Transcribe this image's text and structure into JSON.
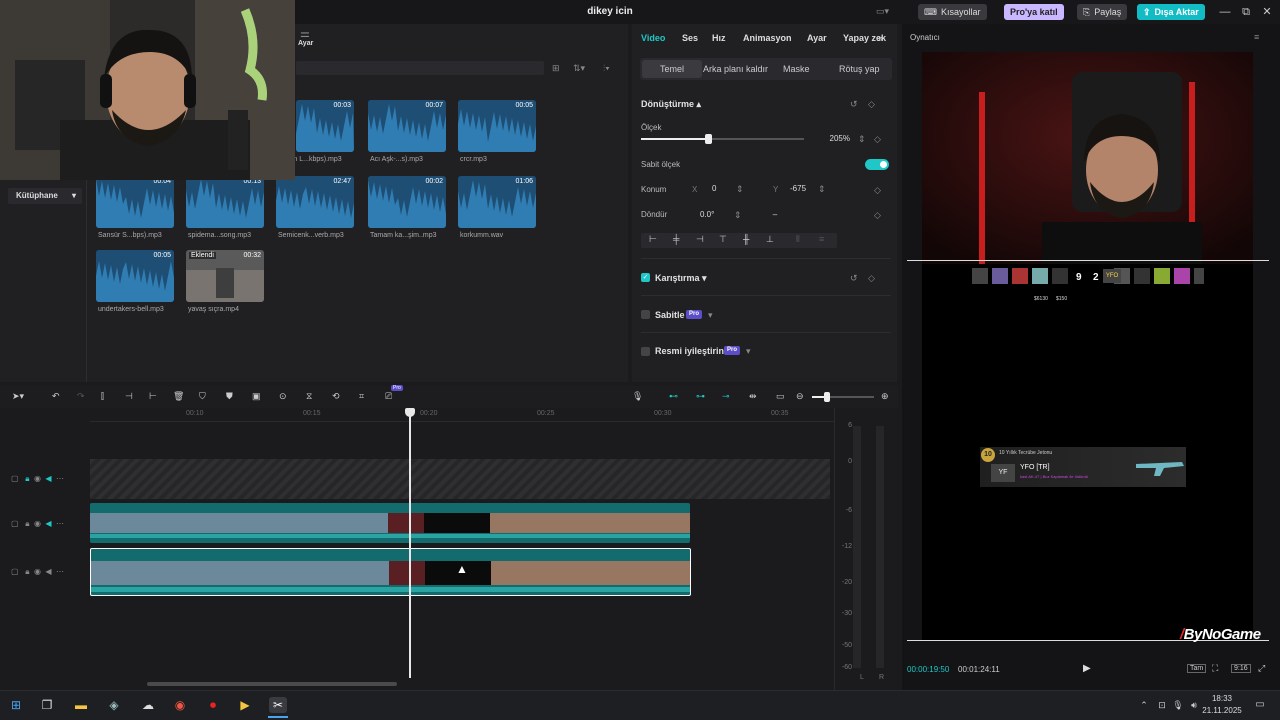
{
  "window": {
    "title": "dikey icin",
    "shortcuts_label": "Kısayollar",
    "pro_label": "Pro'ya katıl",
    "share_label": "Paylaş",
    "export_label": "Dışa Aktar",
    "minimize": "—",
    "maximize": "⧉",
    "close": "✕"
  },
  "media": {
    "settings_label": "Ayar",
    "library_label": "Kütüphane",
    "items": [
      {
        "name": "...in L...kbps).mp3",
        "duration": "00:03"
      },
      {
        "name": "Acı Aşk-...s).mp3",
        "duration": "00:07"
      },
      {
        "name": "crcr.mp3",
        "duration": "00:05"
      },
      {
        "name": "Sansür S...bps).mp3",
        "duration": "00:04"
      },
      {
        "name": "spidema...song.mp3",
        "duration": "00:13"
      },
      {
        "name": "Semicenk...verb.mp3",
        "duration": "02:47"
      },
      {
        "name": "Tamam ka...şim..mp3",
        "duration": "00:02"
      },
      {
        "name": "korkumm.wav",
        "duration": "01:06"
      },
      {
        "name": "undertakers-bell.mp3",
        "duration": "00:05"
      },
      {
        "name": "yavaş sıçra.mp4",
        "duration": "00:32",
        "badge": "Eklendi"
      }
    ]
  },
  "props": {
    "tabs": [
      "Video",
      "Ses",
      "Hız",
      "Animasyon",
      "Ayar",
      "Yapay zek"
    ],
    "subtabs": [
      "Temel",
      "Arka planı kaldır",
      "Maske",
      "Rötuş yap"
    ],
    "transform_label": "Dönüştürme",
    "scale_label": "Ölçek",
    "scale_value": "205%",
    "uniform_scale_label": "Sabit ölçek",
    "position_label": "Konum",
    "x_label": "X",
    "x_value": "0",
    "y_label": "Y",
    "y_value": "-675",
    "rotate_label": "Döndür",
    "rotate_value": "0.0°",
    "rotate_extra": "–",
    "blend_label": "Karıştırma",
    "stabilize_label": "Sabitle",
    "enhance_label": "Resmi iyileştirin",
    "pro_badge": "Pro"
  },
  "player": {
    "title": "Oynatıcı",
    "current_time": "00:00:19:50",
    "total_time": "00:01:24:11",
    "fit_label": "Tam",
    "ratio_label": "9:16",
    "watermark": "ByNoGame",
    "kill_feed": {
      "rank": "10",
      "title": "10 Yıllık Tecrübe Jetonu",
      "player": "YFO [TR]",
      "weapon_line": "kast AK-47 | Buz Kaplamalı ile öldürdü"
    },
    "hud": {
      "money1": "$6130",
      "money2": "$150",
      "score1": "9",
      "score2": "2",
      "team_tag": "YFO"
    }
  },
  "timeline": {
    "ruler": [
      "00:10",
      "00:15",
      "00:20",
      "00:25",
      "00:30",
      "00:35"
    ],
    "meter_labels": [
      "6",
      "0",
      "-6",
      "-12",
      "-20",
      "-30",
      "-50",
      "-60"
    ],
    "meter_lr": [
      "L",
      "R"
    ]
  },
  "taskbar": {
    "time": "18:33",
    "date": "21.11.2025"
  },
  "colors": {
    "accent": "#1fc7c7",
    "pro": "#c9b8ff",
    "export": "#12bcc4",
    "media_thumb": "#1f5b86"
  }
}
